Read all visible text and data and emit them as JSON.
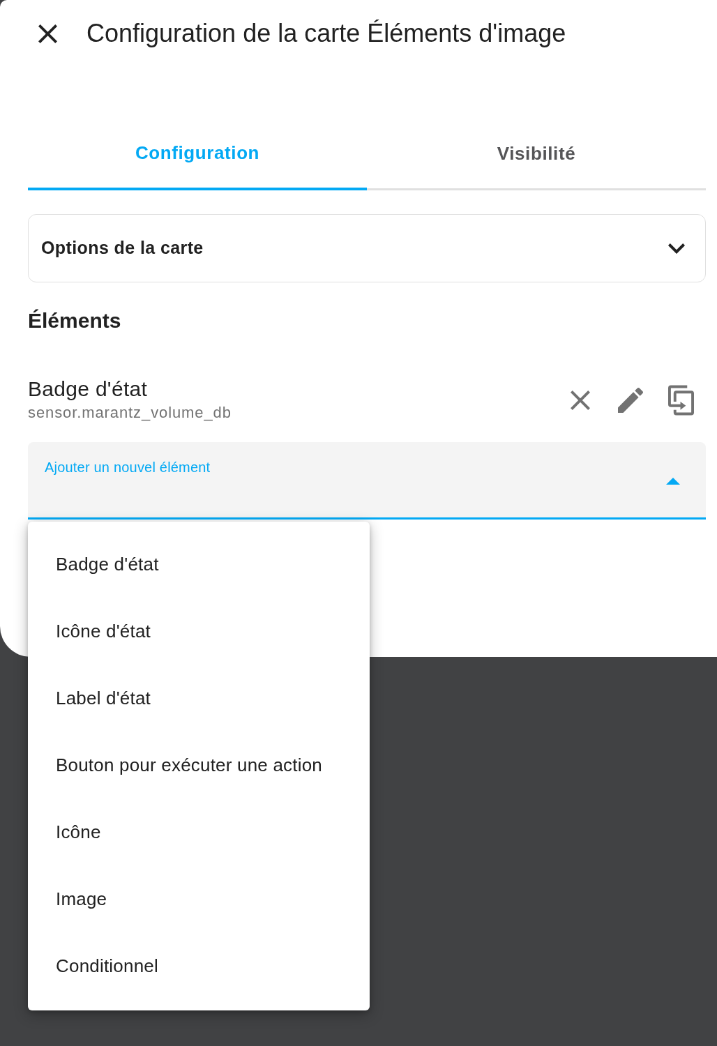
{
  "dialog": {
    "title": "Configuration de la carte Éléments d'image"
  },
  "tabs": [
    {
      "label": "Configuration",
      "selected": true
    },
    {
      "label": "Visibilité",
      "selected": false
    }
  ],
  "card_options": {
    "title": "Options de la carte",
    "expanded": false
  },
  "elements": {
    "heading": "Éléments",
    "items": [
      {
        "name": "Badge d'état",
        "entity": "sensor.marantz_volume_db"
      }
    ]
  },
  "add_element": {
    "label": "Ajouter un nouvel élément",
    "open": true,
    "options": [
      "Badge d'état",
      "Icône d'état",
      "Label d'état",
      "Bouton pour exécuter une action",
      "Icône",
      "Image",
      "Conditionnel"
    ]
  }
}
